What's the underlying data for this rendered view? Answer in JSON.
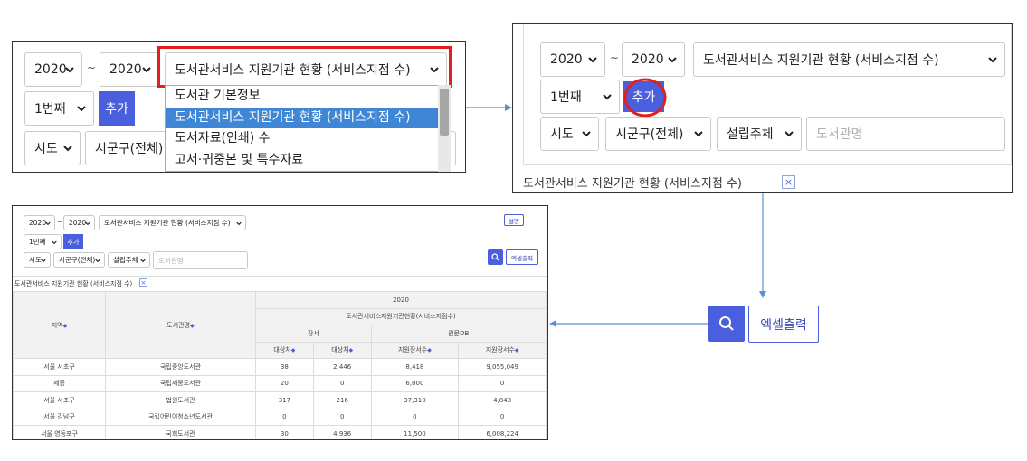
{
  "panel_a": {
    "year_from": "2020",
    "tilde": "~",
    "year_to": "2020",
    "stat_select": "도서관서비스 지원기관 현황 (서비스지점 수)",
    "order_select": "1번째",
    "add_button": "추가",
    "region_select": "시도",
    "district_select": "시군구(전체)",
    "dropdown_options": [
      "도서관 기본정보",
      "도서관서비스 지원기관 현황 (서비스지점 수)",
      "도서자료(인쇄) 수",
      "고서·귀중본 및 특수자료"
    ],
    "dropdown_selected_index": 1
  },
  "panel_b": {
    "year_from": "2020",
    "tilde": "~",
    "year_to": "2020",
    "stat_select": "도서관서비스 지원기관 현황 (서비스지점 수)",
    "order_select": "1번째",
    "add_button": "추가",
    "region_select": "시도",
    "district_select": "시군구(전체)",
    "founder_select": "설립주체",
    "library_name_placeholder": "도서관명",
    "selected_tag": "도서관서비스 지원기관 현황 (서비스지점 수)",
    "tag_remove": "×"
  },
  "panel_c": {
    "year_from": "2020",
    "tilde": "~",
    "year_to": "2020",
    "stat_select": "도서관서비스 지원기관 현황 (서비스지점 수)",
    "description_button": "설명",
    "order_select": "1번째",
    "add_button": "추가",
    "region_select": "시도",
    "district_select": "시군구(전체)",
    "founder_select": "설립주체",
    "library_name_placeholder": "도서관명",
    "excel_button": "엑셀출력",
    "selected_tag": "도서관서비스 지원기관 현황 (서비스지점 수)",
    "tag_remove": "×",
    "table": {
      "year_header": "2020",
      "stat_header": "도서관서비스지원기관현황(서비스지점수)",
      "region_header": "지역",
      "library_header": "도서관명",
      "group_headers": [
        "장서",
        "원문DB"
      ],
      "sub_headers": [
        "대상처",
        "대상처",
        "지원장서수",
        "지원장서수"
      ],
      "rows": [
        {
          "region": "서울 서초구",
          "library": "국립중앙도서관",
          "v1": "38",
          "v2": "2,446",
          "v3": "8,418",
          "v4": "9,055,049"
        },
        {
          "region": "세종",
          "library": "국립세종도서관",
          "v1": "20",
          "v2": "0",
          "v3": "6,000",
          "v4": "0"
        },
        {
          "region": "서울 서초구",
          "library": "법원도서관",
          "v1": "317",
          "v2": "216",
          "v3": "37,310",
          "v4": "4,843"
        },
        {
          "region": "서울 강남구",
          "library": "국립어린이청소년도서관",
          "v1": "0",
          "v2": "0",
          "v3": "0",
          "v4": "0"
        },
        {
          "region": "서울 영등포구",
          "library": "국회도서관",
          "v1": "30",
          "v2": "4,936",
          "v3": "11,500",
          "v4": "6,008,224"
        }
      ]
    }
  },
  "zoom_callout": {
    "excel_button": "엑셀출력"
  },
  "colors": {
    "primary": "#4a5fdd",
    "highlight_red": "#e02020",
    "dropdown_active": "#3f87d6",
    "arrow": "#5b8fd1"
  },
  "icons": [
    "chevron-down-icon",
    "search-icon",
    "close-icon",
    "arrow-right-icon",
    "arrow-down-icon",
    "arrow-left-icon"
  ]
}
